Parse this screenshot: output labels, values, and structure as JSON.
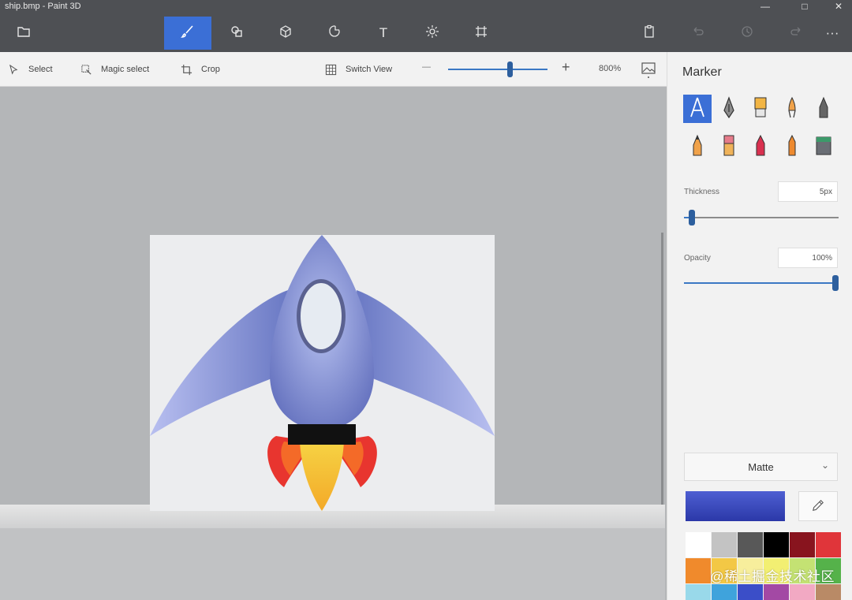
{
  "window": {
    "title": "ship.bmp - Paint 3D",
    "controls": {
      "minimize": "—",
      "maximize": "□",
      "close": "✕"
    }
  },
  "topbar": {
    "items": [
      {
        "name": "menu-icon",
        "active": false
      },
      {
        "name": "brushes-icon",
        "active": true
      },
      {
        "name": "2d-shapes-icon",
        "active": false
      },
      {
        "name": "3d-shapes-icon",
        "active": false
      },
      {
        "name": "stickers-icon",
        "active": false
      },
      {
        "name": "text-icon",
        "active": false
      },
      {
        "name": "effects-icon",
        "active": false
      },
      {
        "name": "canvas-icon",
        "active": false
      },
      {
        "name": "paste-icon",
        "active": false
      },
      {
        "name": "undo-icon",
        "active": false
      },
      {
        "name": "history-icon",
        "active": false
      },
      {
        "name": "redo-icon",
        "active": false
      },
      {
        "name": "more-icon",
        "active": false
      }
    ],
    "text_tool_glyph": "T",
    "more_glyph": "···"
  },
  "subbar": {
    "select": "Select",
    "magic_select": "Magic select",
    "crop": "Crop",
    "switch_view": "Switch View",
    "zoom_minus": "—",
    "zoom_plus": "+",
    "zoom_value": "800%",
    "zoom_fraction": 0.62
  },
  "panel": {
    "title": "Marker",
    "tools": [
      "marker-icon",
      "calligraphy-pen-icon",
      "oil-brush-icon",
      "watercolor-icon",
      "pixel-pen-icon",
      "pencil-icon",
      "eraser-icon",
      "crayon-icon",
      "spray-can-icon",
      "fill-icon"
    ],
    "active_tool": "marker-icon",
    "thickness_label": "Thickness",
    "thickness_value": "5px",
    "thickness_fraction": 0.05,
    "opacity_label": "Opacity",
    "opacity_value": "100%",
    "opacity_fraction": 1.0,
    "finish": "Matte",
    "current_color": "#3b48c0",
    "palette": [
      "#ffffff",
      "#c3c3c3",
      "#585858",
      "#000000",
      "#88141e",
      "#e0353a",
      "#f08a2c",
      "#f3c845",
      "#f7ee9c",
      "#f2ef72",
      "#c4e273",
      "#55b24a",
      "#99d9ea",
      "#3fa3dc",
      "#3b4ec8",
      "#a349a4",
      "#f2a9c3",
      "#b98a66"
    ]
  },
  "watermark": "@稀土掘金技术社区"
}
